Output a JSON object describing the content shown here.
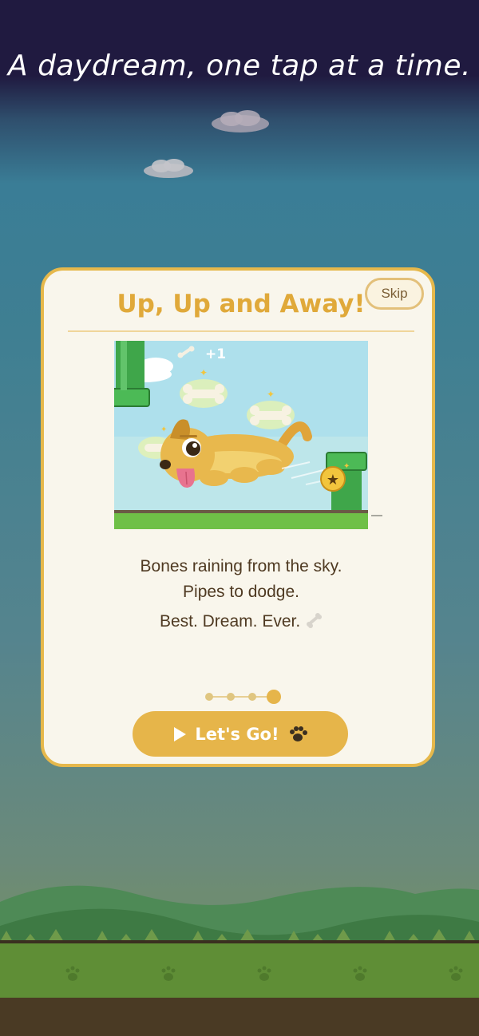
{
  "tagline": "A daydream, one tap at a time.",
  "card": {
    "skip_label": "Skip",
    "title": "Up, Up and Away!",
    "score_popup": "+1",
    "line1": "Bones raining from the sky.",
    "line2": "Pipes to dodge.",
    "line3": "Best. Dream. Ever.",
    "line3_icon": "bone-icon",
    "pagination": {
      "total": 4,
      "current": 4
    },
    "cta_label": "Let's Go!",
    "cta_icons": [
      "play-icon",
      "paw-icon"
    ]
  },
  "colors": {
    "night": "#201a40",
    "accent": "#e6b54a",
    "title": "#e0a93a",
    "card_bg": "#f9f6ec",
    "text": "#4f3a22",
    "pipe": "#3fa64a",
    "grass": "#6fae3c"
  }
}
